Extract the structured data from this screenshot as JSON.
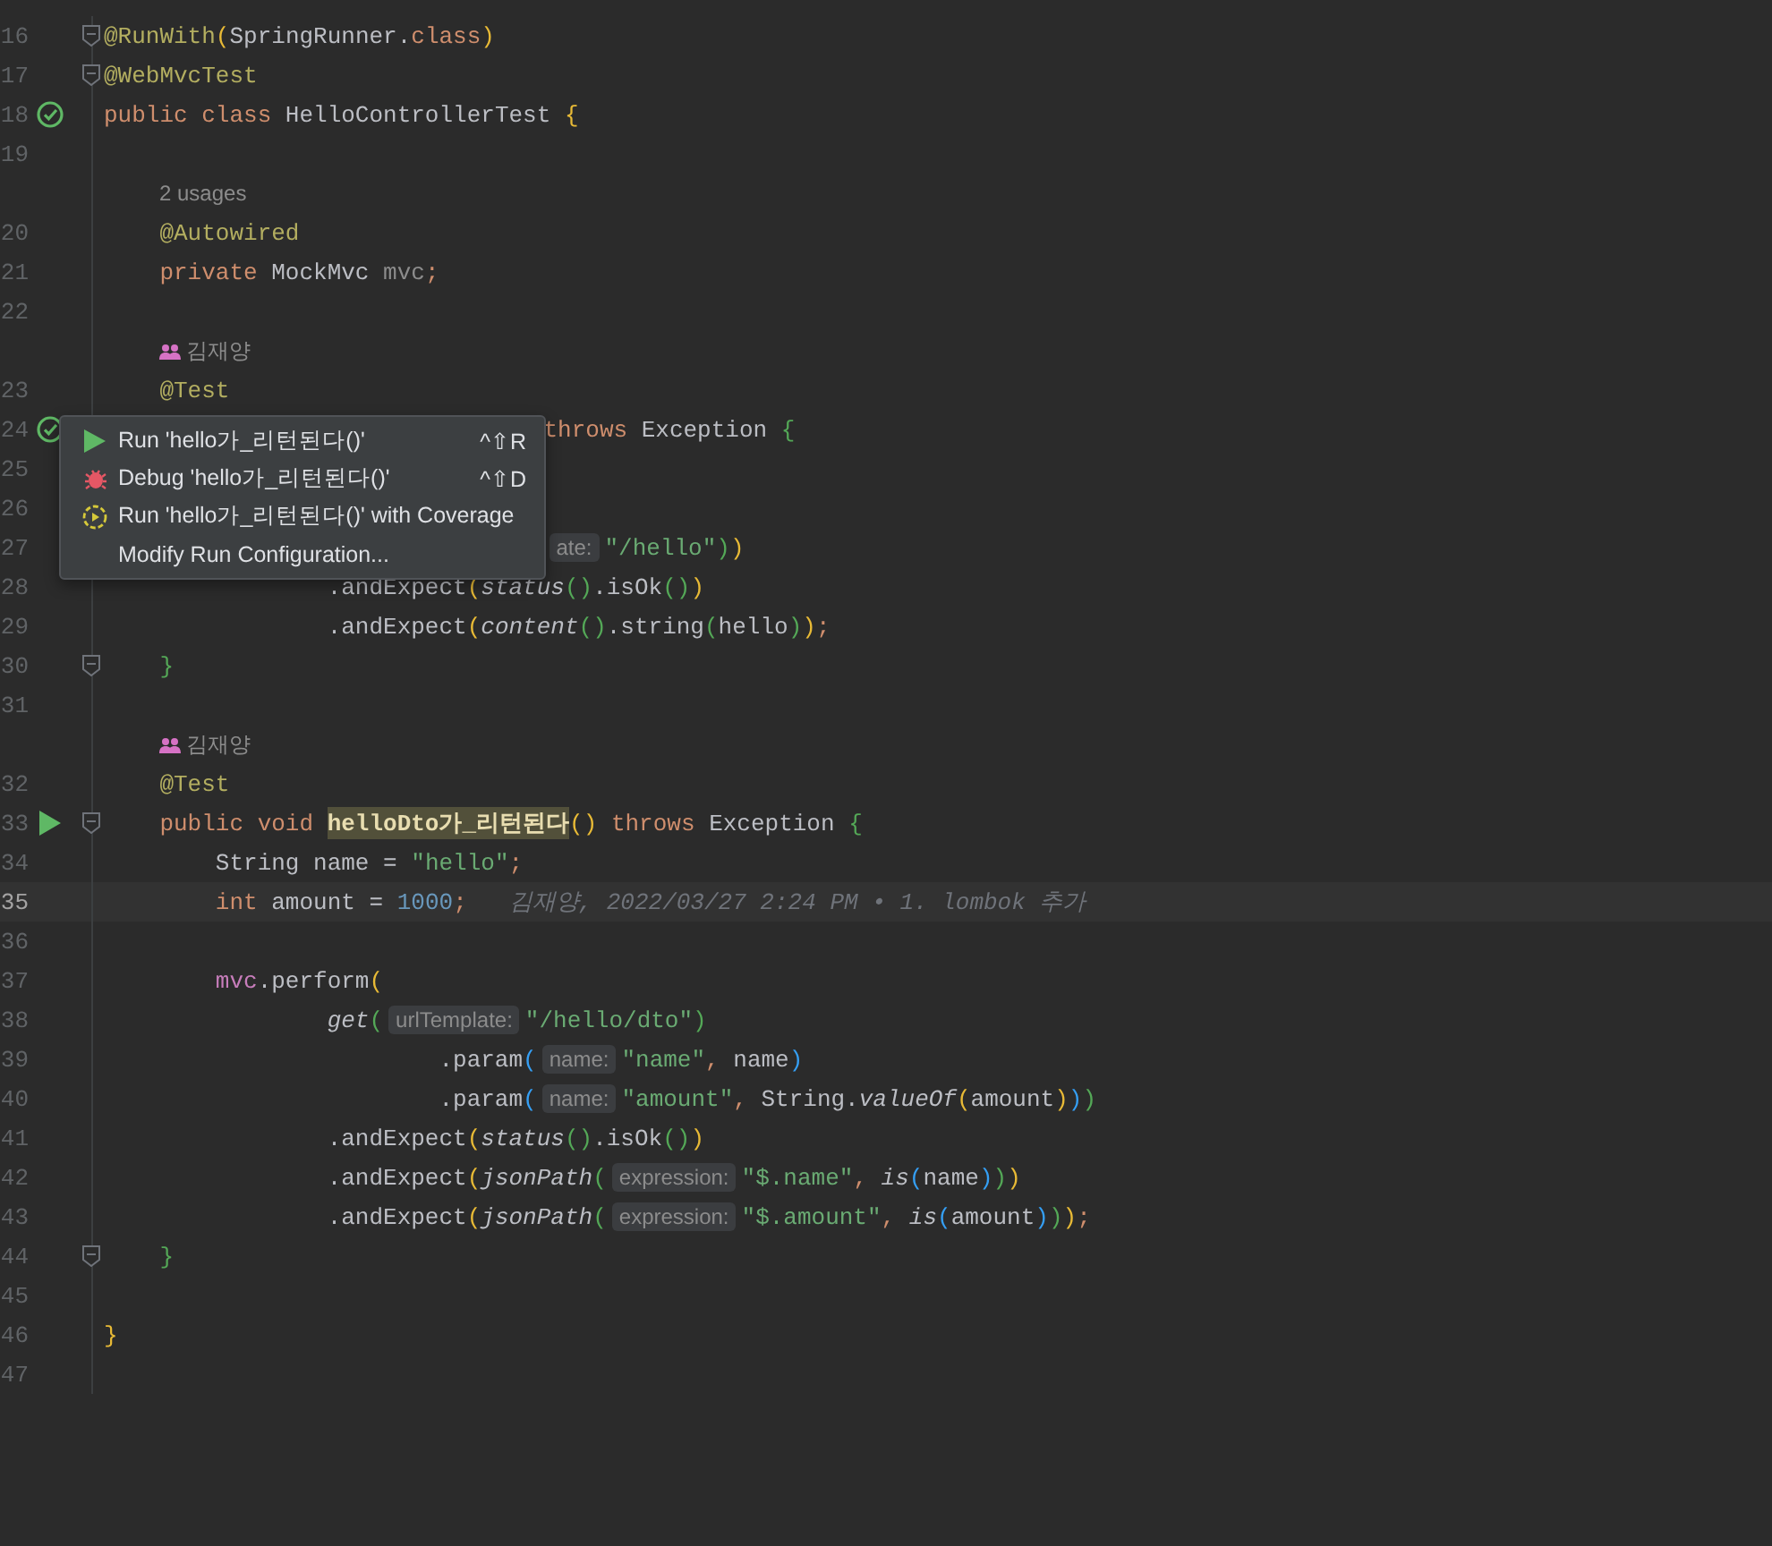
{
  "editor": {
    "rows": [
      {
        "kind": "code",
        "number": "16",
        "fold": true,
        "current": false,
        "passed": false,
        "runnable": false,
        "tokens": [
          {
            "kind": "ann",
            "text": "@RunWith"
          },
          {
            "kind": "p1",
            "text": "("
          },
          {
            "kind": "pl",
            "text": "SpringRunner."
          },
          {
            "kind": "kw",
            "text": "class"
          },
          {
            "kind": "p1",
            "text": ")"
          }
        ]
      },
      {
        "kind": "code",
        "number": "17",
        "fold": true,
        "current": false,
        "passed": false,
        "runnable": false,
        "tokens": [
          {
            "kind": "ann",
            "text": "@WebMvcTest"
          }
        ]
      },
      {
        "kind": "code",
        "number": "18",
        "fold": false,
        "current": false,
        "passed": true,
        "runnable": false,
        "tokens": [
          {
            "kind": "kw",
            "text": "public class "
          },
          {
            "kind": "pl",
            "text": "HelloControllerTest "
          },
          {
            "kind": "p1",
            "text": "{"
          }
        ]
      },
      {
        "kind": "code",
        "number": "19",
        "fold": false,
        "current": false,
        "passed": false,
        "runnable": false,
        "tokens": []
      },
      {
        "kind": "usages",
        "text": "2 usages"
      },
      {
        "kind": "code",
        "number": "20",
        "fold": false,
        "current": false,
        "passed": false,
        "runnable": false,
        "tokens": [
          {
            "kind": "ann",
            "text": "    @Autowired"
          }
        ]
      },
      {
        "kind": "code",
        "number": "21",
        "fold": false,
        "current": false,
        "passed": false,
        "runnable": false,
        "tokens": [
          {
            "kind": "kw",
            "text": "    private "
          },
          {
            "kind": "pl",
            "text": "MockMvc "
          },
          {
            "kind": "fd0",
            "text": "mvc"
          },
          {
            "kind": "kw",
            "text": ";"
          }
        ]
      },
      {
        "kind": "code",
        "number": "22",
        "fold": false,
        "current": false,
        "passed": false,
        "runnable": false,
        "tokens": []
      },
      {
        "kind": "author",
        "text": "김재양"
      },
      {
        "kind": "code",
        "number": "23",
        "fold": false,
        "current": false,
        "passed": false,
        "runnable": false,
        "tokens": [
          {
            "kind": "ann",
            "text": "    @Test"
          }
        ]
      },
      {
        "kind": "code",
        "number": "24",
        "fold": false,
        "current": false,
        "passed": true,
        "runnable": false,
        "tokens": [
          {
            "kind": "gap"
          },
          {
            "kind": "kw",
            "text": "throws "
          },
          {
            "kind": "pl",
            "text": "Exception "
          },
          {
            "kind": "p2",
            "text": "{"
          }
        ]
      },
      {
        "kind": "code",
        "number": "25",
        "fold": false,
        "current": false,
        "passed": false,
        "runnable": false,
        "tokens": []
      },
      {
        "kind": "code",
        "number": "26",
        "fold": false,
        "current": false,
        "passed": false,
        "runnable": false,
        "tokens": []
      },
      {
        "kind": "code",
        "number": "27",
        "fold": false,
        "current": false,
        "passed": false,
        "runnable": false,
        "tokens": [
          {
            "kind": "gap"
          },
          {
            "kind": "hint",
            "text": "ate:"
          },
          {
            "kind": "st",
            "text": "\"/hello\""
          },
          {
            "kind": "p2",
            "text": ")"
          },
          {
            "kind": "p1",
            "text": ")"
          }
        ]
      },
      {
        "kind": "code",
        "number": "28",
        "fold": false,
        "current": false,
        "passed": false,
        "runnable": false,
        "tokens": [
          {
            "kind": "pl",
            "text": "                .andExpect"
          },
          {
            "kind": "p1",
            "text": "("
          },
          {
            "kind": "it",
            "text": "status"
          },
          {
            "kind": "p2",
            "text": "()"
          },
          {
            "kind": "pl",
            "text": ".isOk"
          },
          {
            "kind": "p2",
            "text": "()"
          },
          {
            "kind": "p1",
            "text": ")"
          }
        ]
      },
      {
        "kind": "code",
        "number": "29",
        "fold": false,
        "current": false,
        "passed": false,
        "runnable": false,
        "tokens": [
          {
            "kind": "pl",
            "text": "                .andExpect"
          },
          {
            "kind": "p1",
            "text": "("
          },
          {
            "kind": "it",
            "text": "content"
          },
          {
            "kind": "p2",
            "text": "()"
          },
          {
            "kind": "pl",
            "text": ".string"
          },
          {
            "kind": "p2",
            "text": "("
          },
          {
            "kind": "pl",
            "text": "hello"
          },
          {
            "kind": "p2",
            "text": ")"
          },
          {
            "kind": "p1",
            "text": ")"
          },
          {
            "kind": "kw",
            "text": ";"
          }
        ]
      },
      {
        "kind": "code",
        "number": "30",
        "fold": true,
        "current": false,
        "passed": false,
        "runnable": false,
        "tokens": [
          {
            "kind": "p2",
            "text": "    }"
          }
        ]
      },
      {
        "kind": "code",
        "number": "31",
        "fold": false,
        "current": false,
        "passed": false,
        "runnable": false,
        "tokens": []
      },
      {
        "kind": "author",
        "text": "김재양"
      },
      {
        "kind": "code",
        "number": "32",
        "fold": false,
        "current": false,
        "passed": false,
        "runnable": false,
        "tokens": [
          {
            "kind": "ann",
            "text": "    @Test"
          }
        ]
      },
      {
        "kind": "code",
        "number": "33",
        "fold": true,
        "current": false,
        "passed": false,
        "runnable": true,
        "tokens": [
          {
            "kind": "kw",
            "text": "    public void "
          },
          {
            "kind": "hl",
            "text": "helloDto가_리턴된다"
          },
          {
            "kind": "p1",
            "text": "()"
          },
          {
            "kind": "kw",
            "text": " throws "
          },
          {
            "kind": "pl",
            "text": "Exception "
          },
          {
            "kind": "p2",
            "text": "{"
          }
        ]
      },
      {
        "kind": "code",
        "number": "34",
        "fold": false,
        "current": false,
        "passed": false,
        "runnable": false,
        "tokens": [
          {
            "kind": "pl",
            "text": "        String name = "
          },
          {
            "kind": "st",
            "text": "\"hello\""
          },
          {
            "kind": "kw",
            "text": ";"
          }
        ]
      },
      {
        "kind": "code",
        "number": "35",
        "fold": false,
        "current": true,
        "passed": false,
        "runnable": false,
        "tokens": [
          {
            "kind": "kw",
            "text": "        int "
          },
          {
            "kind": "pl",
            "text": "amount = "
          },
          {
            "kind": "num",
            "text": "1000"
          },
          {
            "kind": "kw",
            "text": ";"
          },
          {
            "kind": "blame",
            "text": "김재양, 2022/03/27 2:24 PM • 1. lombok 추가"
          }
        ]
      },
      {
        "kind": "code",
        "number": "36",
        "fold": false,
        "current": false,
        "passed": false,
        "runnable": false,
        "tokens": []
      },
      {
        "kind": "code",
        "number": "37",
        "fold": false,
        "current": false,
        "passed": false,
        "runnable": false,
        "tokens": [
          {
            "kind": "fd",
            "text": "        mvc"
          },
          {
            "kind": "pl",
            "text": ".perform"
          },
          {
            "kind": "p1",
            "text": "("
          }
        ]
      },
      {
        "kind": "code",
        "number": "38",
        "fold": false,
        "current": false,
        "passed": false,
        "runnable": false,
        "tokens": [
          {
            "kind": "it",
            "text": "                get"
          },
          {
            "kind": "p2",
            "text": "("
          },
          {
            "kind": "hint",
            "text": "urlTemplate:"
          },
          {
            "kind": "st",
            "text": "\"/hello/dto\""
          },
          {
            "kind": "p2",
            "text": ")"
          }
        ]
      },
      {
        "kind": "code",
        "number": "39",
        "fold": false,
        "current": false,
        "passed": false,
        "runnable": false,
        "tokens": [
          {
            "kind": "pl",
            "text": "                        .param"
          },
          {
            "kind": "p3",
            "text": "("
          },
          {
            "kind": "hint",
            "text": "name:"
          },
          {
            "kind": "st",
            "text": "\"name\""
          },
          {
            "kind": "kw",
            "text": ", "
          },
          {
            "kind": "pl",
            "text": "name"
          },
          {
            "kind": "p3",
            "text": ")"
          }
        ]
      },
      {
        "kind": "code",
        "number": "40",
        "fold": false,
        "current": false,
        "passed": false,
        "runnable": false,
        "tokens": [
          {
            "kind": "pl",
            "text": "                        .param"
          },
          {
            "kind": "p3",
            "text": "("
          },
          {
            "kind": "hint",
            "text": "name:"
          },
          {
            "kind": "st",
            "text": "\"amount\""
          },
          {
            "kind": "kw",
            "text": ", "
          },
          {
            "kind": "pl",
            "text": "String."
          },
          {
            "kind": "it",
            "text": "valueOf"
          },
          {
            "kind": "p1",
            "text": "("
          },
          {
            "kind": "pl",
            "text": "amount"
          },
          {
            "kind": "p1",
            "text": ")"
          },
          {
            "kind": "p3",
            "text": ")"
          },
          {
            "kind": "p2",
            "text": ")"
          }
        ]
      },
      {
        "kind": "code",
        "number": "41",
        "fold": false,
        "current": false,
        "passed": false,
        "runnable": false,
        "tokens": [
          {
            "kind": "pl",
            "text": "                .andExpect"
          },
          {
            "kind": "p1",
            "text": "("
          },
          {
            "kind": "it",
            "text": "status"
          },
          {
            "kind": "p2",
            "text": "()"
          },
          {
            "kind": "pl",
            "text": ".isOk"
          },
          {
            "kind": "p2",
            "text": "()"
          },
          {
            "kind": "p1",
            "text": ")"
          }
        ]
      },
      {
        "kind": "code",
        "number": "42",
        "fold": false,
        "current": false,
        "passed": false,
        "runnable": false,
        "tokens": [
          {
            "kind": "pl",
            "text": "                .andExpect"
          },
          {
            "kind": "p1",
            "text": "("
          },
          {
            "kind": "it",
            "text": "jsonPath"
          },
          {
            "kind": "p2",
            "text": "("
          },
          {
            "kind": "hint",
            "text": "expression:"
          },
          {
            "kind": "st",
            "text": "\"$.name\""
          },
          {
            "kind": "kw",
            "text": ", "
          },
          {
            "kind": "it",
            "text": "is"
          },
          {
            "kind": "p3",
            "text": "("
          },
          {
            "kind": "pl",
            "text": "name"
          },
          {
            "kind": "p3",
            "text": ")"
          },
          {
            "kind": "p2",
            "text": ")"
          },
          {
            "kind": "p1",
            "text": ")"
          }
        ]
      },
      {
        "kind": "code",
        "number": "43",
        "fold": false,
        "current": false,
        "passed": false,
        "runnable": false,
        "tokens": [
          {
            "kind": "pl",
            "text": "                .andExpect"
          },
          {
            "kind": "p1",
            "text": "("
          },
          {
            "kind": "it",
            "text": "jsonPath"
          },
          {
            "kind": "p2",
            "text": "("
          },
          {
            "kind": "hint",
            "text": "expression:"
          },
          {
            "kind": "st",
            "text": "\"$.amount\""
          },
          {
            "kind": "kw",
            "text": ", "
          },
          {
            "kind": "it",
            "text": "is"
          },
          {
            "kind": "p3",
            "text": "("
          },
          {
            "kind": "pl",
            "text": "amount"
          },
          {
            "kind": "p3",
            "text": ")"
          },
          {
            "kind": "p2",
            "text": ")"
          },
          {
            "kind": "p1",
            "text": ")"
          },
          {
            "kind": "kw",
            "text": ";"
          }
        ]
      },
      {
        "kind": "code",
        "number": "44",
        "fold": true,
        "current": false,
        "passed": false,
        "runnable": false,
        "tokens": [
          {
            "kind": "p2",
            "text": "    }"
          }
        ]
      },
      {
        "kind": "code",
        "number": "45",
        "fold": false,
        "current": false,
        "passed": false,
        "runnable": false,
        "tokens": []
      },
      {
        "kind": "code",
        "number": "46",
        "fold": false,
        "current": false,
        "passed": false,
        "runnable": false,
        "tokens": [
          {
            "kind": "p1",
            "text": "}"
          }
        ]
      },
      {
        "kind": "code",
        "number": "47",
        "fold": false,
        "current": false,
        "passed": false,
        "runnable": false,
        "tokens": []
      }
    ]
  },
  "popup_menu": {
    "items": [
      {
        "kind": "run",
        "label": "Run 'hello가_리턴된다()'",
        "shortcut": "^⇧R"
      },
      {
        "kind": "debug",
        "label": "Debug 'hello가_리턴된다()'",
        "shortcut": "^⇧D"
      },
      {
        "kind": "coverage",
        "label": "Run 'hello가_리턴된다()' with Coverage"
      },
      {
        "kind": "plain",
        "label": "Modify Run Configuration..."
      }
    ]
  }
}
